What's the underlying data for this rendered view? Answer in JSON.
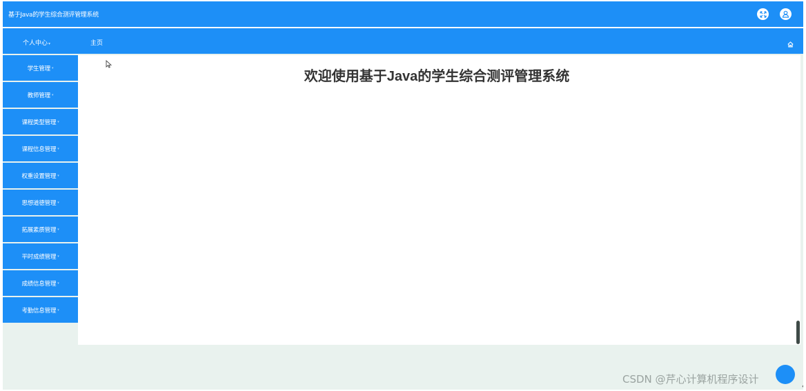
{
  "app": {
    "title": "基于Java的学生综合测评管理系统"
  },
  "header": {
    "personal_center": "个人中心",
    "breadcrumb_home": "主页"
  },
  "sidebar": {
    "items": [
      {
        "label": "学生管理"
      },
      {
        "label": "教师管理"
      },
      {
        "label": "课程类型管理"
      },
      {
        "label": "课程信息管理"
      },
      {
        "label": "权重设置管理"
      },
      {
        "label": "思想道德管理"
      },
      {
        "label": "拓展素质管理"
      },
      {
        "label": "平时成绩管理"
      },
      {
        "label": "成绩信息管理"
      },
      {
        "label": "考勤信息管理"
      }
    ]
  },
  "main": {
    "welcome": "欢迎使用基于Java的学生综合测评管理系统"
  },
  "watermark": "CSDN @芹心计算机程序设计",
  "icons": {
    "fullscreen": "fullscreen-toggle-icon",
    "user": "user-avatar-icon",
    "home": "home-icon",
    "cursor": "mouse-pointer-icon",
    "caret": "chevron-down-icon"
  },
  "colors": {
    "primary": "#1d8ff7",
    "background": "#e9f2ee",
    "text": "#333333"
  }
}
